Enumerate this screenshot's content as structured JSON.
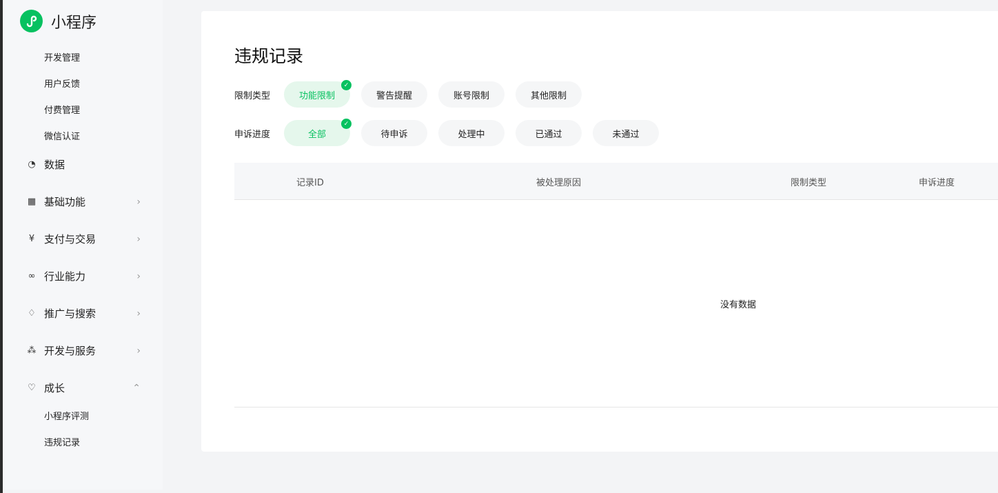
{
  "app": {
    "title": "小程序",
    "accent": "#07c160"
  },
  "sidebar": {
    "top_items": [
      "开发管理",
      "用户反馈",
      "付费管理",
      "微信认证"
    ],
    "groups": [
      {
        "label": "数据",
        "icon": "pie-chart-icon"
      },
      {
        "label": "基础功能",
        "icon": "grid-icon"
      },
      {
        "label": "支付与交易",
        "icon": "yen-icon"
      },
      {
        "label": "行业能力",
        "icon": "nodes-icon"
      },
      {
        "label": "推广与搜索",
        "icon": "flame-icon"
      },
      {
        "label": "开发与服务",
        "icon": "circles-icon"
      },
      {
        "label": "成长",
        "icon": "heart-hands-icon"
      }
    ],
    "growth_items": [
      "小程序评测",
      "违规记录"
    ]
  },
  "page": {
    "title": "违规记录",
    "filter_type": {
      "label": "限制类型",
      "options": [
        "功能限制",
        "警告提醒",
        "账号限制",
        "其他限制"
      ],
      "selected": 0
    },
    "filter_progress": {
      "label": "申诉进度",
      "options": [
        "全部",
        "待申诉",
        "处理中",
        "已通过",
        "未通过"
      ],
      "selected": 0
    },
    "table": {
      "columns": [
        "记录ID",
        "被处理原因",
        "限制类型",
        "申诉进度"
      ],
      "empty": "没有数据"
    }
  }
}
